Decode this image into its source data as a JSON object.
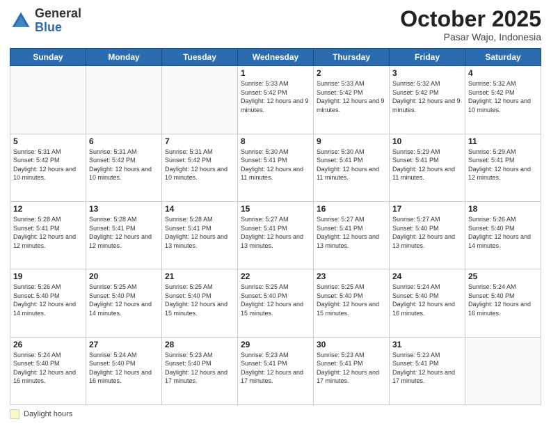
{
  "logo": {
    "general": "General",
    "blue": "Blue"
  },
  "title": "October 2025",
  "location": "Pasar Wajo, Indonesia",
  "days_of_week": [
    "Sunday",
    "Monday",
    "Tuesday",
    "Wednesday",
    "Thursday",
    "Friday",
    "Saturday"
  ],
  "legend": {
    "label": "Daylight hours"
  },
  "weeks": [
    [
      {
        "day": "",
        "info": ""
      },
      {
        "day": "",
        "info": ""
      },
      {
        "day": "",
        "info": ""
      },
      {
        "day": "1",
        "info": "Sunrise: 5:33 AM\nSunset: 5:42 PM\nDaylight: 12 hours\nand 9 minutes."
      },
      {
        "day": "2",
        "info": "Sunrise: 5:33 AM\nSunset: 5:42 PM\nDaylight: 12 hours\nand 9 minutes."
      },
      {
        "day": "3",
        "info": "Sunrise: 5:32 AM\nSunset: 5:42 PM\nDaylight: 12 hours\nand 9 minutes."
      },
      {
        "day": "4",
        "info": "Sunrise: 5:32 AM\nSunset: 5:42 PM\nDaylight: 12 hours\nand 10 minutes."
      }
    ],
    [
      {
        "day": "5",
        "info": "Sunrise: 5:31 AM\nSunset: 5:42 PM\nDaylight: 12 hours\nand 10 minutes."
      },
      {
        "day": "6",
        "info": "Sunrise: 5:31 AM\nSunset: 5:42 PM\nDaylight: 12 hours\nand 10 minutes."
      },
      {
        "day": "7",
        "info": "Sunrise: 5:31 AM\nSunset: 5:42 PM\nDaylight: 12 hours\nand 10 minutes."
      },
      {
        "day": "8",
        "info": "Sunrise: 5:30 AM\nSunset: 5:41 PM\nDaylight: 12 hours\nand 11 minutes."
      },
      {
        "day": "9",
        "info": "Sunrise: 5:30 AM\nSunset: 5:41 PM\nDaylight: 12 hours\nand 11 minutes."
      },
      {
        "day": "10",
        "info": "Sunrise: 5:29 AM\nSunset: 5:41 PM\nDaylight: 12 hours\nand 11 minutes."
      },
      {
        "day": "11",
        "info": "Sunrise: 5:29 AM\nSunset: 5:41 PM\nDaylight: 12 hours\nand 12 minutes."
      }
    ],
    [
      {
        "day": "12",
        "info": "Sunrise: 5:28 AM\nSunset: 5:41 PM\nDaylight: 12 hours\nand 12 minutes."
      },
      {
        "day": "13",
        "info": "Sunrise: 5:28 AM\nSunset: 5:41 PM\nDaylight: 12 hours\nand 12 minutes."
      },
      {
        "day": "14",
        "info": "Sunrise: 5:28 AM\nSunset: 5:41 PM\nDaylight: 12 hours\nand 13 minutes."
      },
      {
        "day": "15",
        "info": "Sunrise: 5:27 AM\nSunset: 5:41 PM\nDaylight: 12 hours\nand 13 minutes."
      },
      {
        "day": "16",
        "info": "Sunrise: 5:27 AM\nSunset: 5:41 PM\nDaylight: 12 hours\nand 13 minutes."
      },
      {
        "day": "17",
        "info": "Sunrise: 5:27 AM\nSunset: 5:40 PM\nDaylight: 12 hours\nand 13 minutes."
      },
      {
        "day": "18",
        "info": "Sunrise: 5:26 AM\nSunset: 5:40 PM\nDaylight: 12 hours\nand 14 minutes."
      }
    ],
    [
      {
        "day": "19",
        "info": "Sunrise: 5:26 AM\nSunset: 5:40 PM\nDaylight: 12 hours\nand 14 minutes."
      },
      {
        "day": "20",
        "info": "Sunrise: 5:25 AM\nSunset: 5:40 PM\nDaylight: 12 hours\nand 14 minutes."
      },
      {
        "day": "21",
        "info": "Sunrise: 5:25 AM\nSunset: 5:40 PM\nDaylight: 12 hours\nand 15 minutes."
      },
      {
        "day": "22",
        "info": "Sunrise: 5:25 AM\nSunset: 5:40 PM\nDaylight: 12 hours\nand 15 minutes."
      },
      {
        "day": "23",
        "info": "Sunrise: 5:25 AM\nSunset: 5:40 PM\nDaylight: 12 hours\nand 15 minutes."
      },
      {
        "day": "24",
        "info": "Sunrise: 5:24 AM\nSunset: 5:40 PM\nDaylight: 12 hours\nand 16 minutes."
      },
      {
        "day": "25",
        "info": "Sunrise: 5:24 AM\nSunset: 5:40 PM\nDaylight: 12 hours\nand 16 minutes."
      }
    ],
    [
      {
        "day": "26",
        "info": "Sunrise: 5:24 AM\nSunset: 5:40 PM\nDaylight: 12 hours\nand 16 minutes."
      },
      {
        "day": "27",
        "info": "Sunrise: 5:24 AM\nSunset: 5:40 PM\nDaylight: 12 hours\nand 16 minutes."
      },
      {
        "day": "28",
        "info": "Sunrise: 5:23 AM\nSunset: 5:40 PM\nDaylight: 12 hours\nand 17 minutes."
      },
      {
        "day": "29",
        "info": "Sunrise: 5:23 AM\nSunset: 5:41 PM\nDaylight: 12 hours\nand 17 minutes."
      },
      {
        "day": "30",
        "info": "Sunrise: 5:23 AM\nSunset: 5:41 PM\nDaylight: 12 hours\nand 17 minutes."
      },
      {
        "day": "31",
        "info": "Sunrise: 5:23 AM\nSunset: 5:41 PM\nDaylight: 12 hours\nand 17 minutes."
      },
      {
        "day": "",
        "info": ""
      }
    ]
  ]
}
